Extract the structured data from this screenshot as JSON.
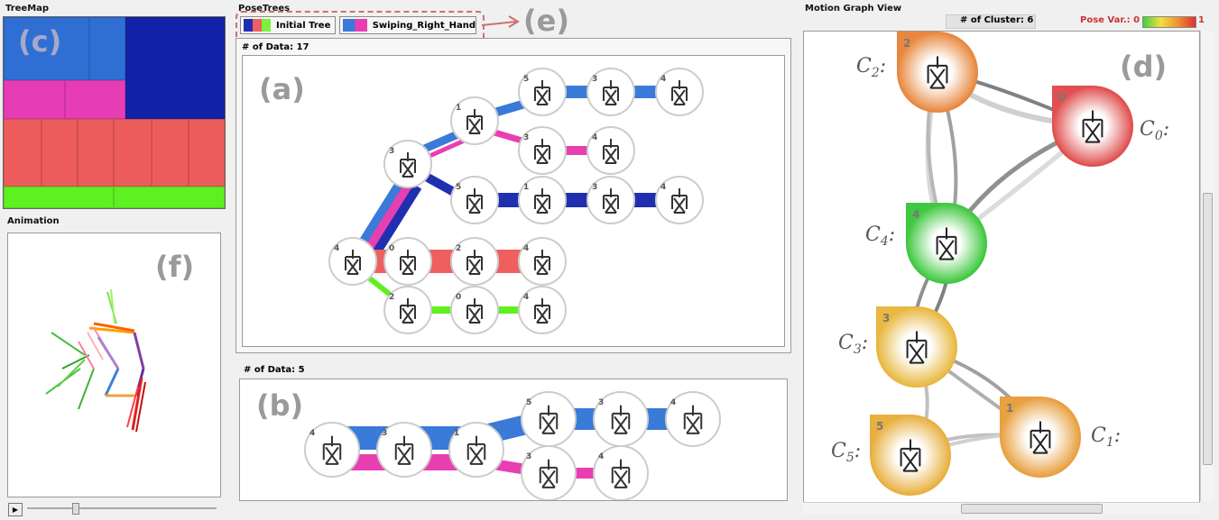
{
  "panels": {
    "treemap_title": "TreeMap",
    "animation_title": "Animation",
    "posetrees_title": "PoseTrees",
    "motion_title": "Motion Graph View"
  },
  "labels": {
    "a": "(a)",
    "b": "(b)",
    "c": "(c)",
    "d": "(d)",
    "e": "(e)",
    "f": "(f)"
  },
  "tabs": [
    {
      "label": "Initial Tree",
      "colors": [
        "#1f2fb0",
        "#ef5f5f",
        "#7cf03a"
      ]
    },
    {
      "label": "Swiping_Right_Hand",
      "colors": [
        "#3a7ad8",
        "#e83fb0"
      ]
    }
  ],
  "tree_a": {
    "header": "# of Data: 17",
    "nodes": [
      "4",
      "3",
      "1",
      "5",
      "3",
      "4",
      "3",
      "4",
      "5",
      "1",
      "3",
      "4",
      "0",
      "2",
      "4",
      "2",
      "0",
      "4"
    ]
  },
  "tree_b": {
    "header": "# of Data: 5",
    "nodes": [
      "4",
      "3",
      "1",
      "5",
      "3",
      "4",
      "3",
      "4"
    ]
  },
  "motion": {
    "cluster_label": "# of Cluster: 6",
    "posevar_label": "Pose Var.: 0",
    "posevar_max": "1",
    "clusters": [
      {
        "id": "0",
        "label_main": "C",
        "label_sub": "0",
        "color": "#e05050"
      },
      {
        "id": "1",
        "label_main": "C",
        "label_sub": "1",
        "color": "#e8a040"
      },
      {
        "id": "2",
        "label_main": "C",
        "label_sub": "2",
        "color": "#e88840"
      },
      {
        "id": "3",
        "label_main": "C",
        "label_sub": "3",
        "color": "#e8b840"
      },
      {
        "id": "4",
        "label_main": "C",
        "label_sub": "4",
        "color": "#40c840"
      },
      {
        "id": "5",
        "label_main": "C",
        "label_sub": "5",
        "color": "#e8b040"
      }
    ]
  },
  "colors": {
    "dark_blue": "#1f2fb0",
    "light_blue": "#3a7ad8",
    "pink": "#e83fb0",
    "salmon": "#ef5f5f",
    "green": "#60f020"
  }
}
